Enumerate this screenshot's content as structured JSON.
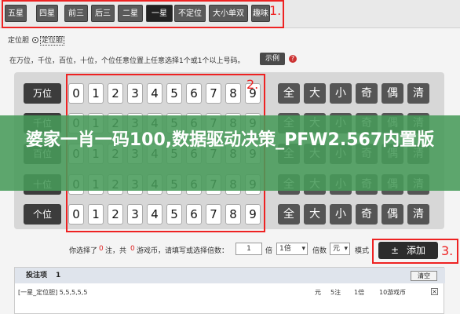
{
  "tabs": [
    "五星",
    "四星",
    "前三",
    "后三",
    "二星",
    "一星",
    "不定位",
    "大小单双",
    "趣味"
  ],
  "active_tab": "一星",
  "annotations": [
    "1.",
    "2.",
    "3."
  ],
  "mode": {
    "label": "定位胆",
    "selected": "定位胆"
  },
  "hint": "在万位，千位，百位，十位，个位任意位置上任意选择1个或1个以上号码。",
  "example_label": "示例",
  "positions": [
    "万位",
    "千位",
    "百位",
    "十位",
    "个位"
  ],
  "digits": [
    "0",
    "1",
    "2",
    "3",
    "4",
    "5",
    "6",
    "7",
    "8",
    "9"
  ],
  "controls": [
    "全",
    "大",
    "小",
    "奇",
    "偶",
    "清"
  ],
  "banner": "婆家一肖一码100,数据驱动决策_PFW2.567内置版",
  "bet": {
    "text_prefix": "你选择了",
    "count": "0",
    "text_mid1": "注，共",
    "coins": "0",
    "text_mid2": "游戏币，请填写或选择倍数：",
    "multiple": "1",
    "multiple_unit": "倍",
    "multiple_select": "1倍",
    "mode_label": "倍数",
    "mode_select": "元",
    "mode_text": "模式",
    "add_label": "添加"
  },
  "list": {
    "header": "投注项",
    "header_count": "1",
    "clear_label": "清空",
    "rows": [
      {
        "item": "[一星_定位胆] 5,5,5,5,5",
        "unit": "元",
        "count": "5注",
        "mult": "1倍",
        "amount": "10游戏币"
      }
    ]
  }
}
